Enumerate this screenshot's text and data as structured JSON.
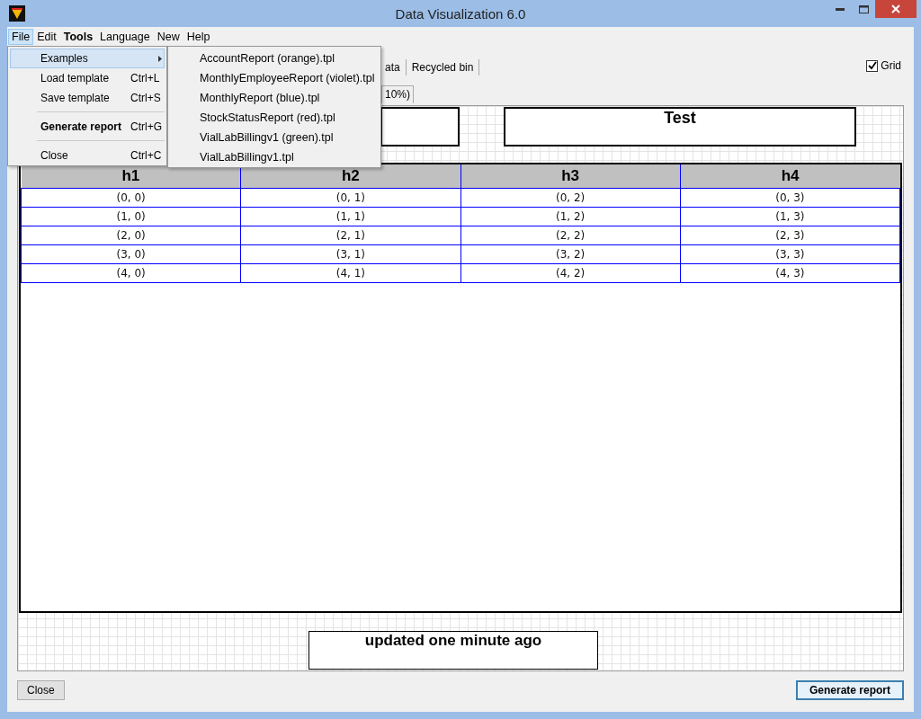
{
  "window": {
    "title": "Data Visualization 6.0"
  },
  "menu_bar": [
    {
      "label": "File",
      "selected": true,
      "bold": false
    },
    {
      "label": "Edit",
      "selected": false,
      "bold": false
    },
    {
      "label": "Tools",
      "selected": false,
      "bold": true
    },
    {
      "label": "Language",
      "selected": false,
      "bold": false
    },
    {
      "label": "New",
      "selected": false,
      "bold": false
    },
    {
      "label": "Help",
      "selected": false,
      "bold": false
    }
  ],
  "file_menu": [
    {
      "kind": "item",
      "label": "Examples",
      "selected": true,
      "bold": false,
      "submenu": true
    },
    {
      "kind": "item",
      "label": "Load template",
      "shortcut": "Ctrl+L",
      "selected": false,
      "bold": false,
      "submenu": false
    },
    {
      "kind": "item",
      "label": "Save template",
      "shortcut": "Ctrl+S",
      "selected": false,
      "bold": false,
      "submenu": false
    },
    {
      "kind": "separator"
    },
    {
      "kind": "item",
      "label": "Generate report",
      "shortcut": "Ctrl+G",
      "selected": false,
      "bold": true,
      "submenu": false
    },
    {
      "kind": "separator"
    },
    {
      "kind": "item",
      "label": "Close",
      "shortcut": "Ctrl+C",
      "selected": false,
      "bold": false,
      "submenu": false
    }
  ],
  "examples_submenu": [
    {
      "label": "AccountReport (orange).tpl",
      "selected": false
    },
    {
      "label": "MonthlyEmployeeReport (violet).tpl",
      "selected": false
    },
    {
      "label": "MonthlyReport (blue).tpl",
      "selected": false
    },
    {
      "label": "StockStatusReport (red).tpl",
      "selected": false
    },
    {
      "label": "VialLabBillingv1 (green).tpl",
      "selected": false
    },
    {
      "label": "VialLabBillingv1.tpl",
      "selected": false
    }
  ],
  "toolbar": [
    {
      "label": "ata"
    },
    {
      "label": "Recycled bin"
    }
  ],
  "grid_checkbox": {
    "label": "Grid",
    "checked": true
  },
  "tabs": [
    {
      "label": "10%)",
      "selected": false
    }
  ],
  "report": {
    "header_title": "Test",
    "columns": [
      "h1",
      "h2",
      "h3",
      "h4"
    ],
    "rows": [
      [
        "(0, 0)",
        "(0, 1)",
        "(0, 2)",
        "(0, 3)"
      ],
      [
        "(1, 0)",
        "(1, 1)",
        "(1, 2)",
        "(1, 3)"
      ],
      [
        "(2, 0)",
        "(2, 1)",
        "(2, 2)",
        "(2, 3)"
      ],
      [
        "(3, 0)",
        "(3, 1)",
        "(3, 2)",
        "(3, 3)"
      ],
      [
        "(4, 0)",
        "(4, 1)",
        "(4, 2)",
        "(4, 3)"
      ]
    ],
    "footer": "updated one minute ago"
  },
  "buttons": [
    {
      "label": "Close",
      "default": false
    },
    {
      "label": "Generate report",
      "default": true
    }
  ]
}
